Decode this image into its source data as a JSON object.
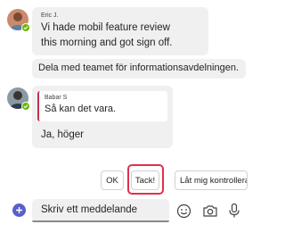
{
  "messages": [
    {
      "sender": "Eric J.",
      "lines": [
        "Vi hade mobil feature review",
        "this morning and got sign off."
      ],
      "followup": "Dela med teamet för informationsavdelningen."
    },
    {
      "sender": "Babar S",
      "quote_text": "Så kan det vara.",
      "reply": "Ja, höger"
    }
  ],
  "suggestions": [
    "OK",
    "Tack!",
    "Låt mig kontrollera"
  ],
  "composer": {
    "placeholder": "Skriv ett meddelande"
  },
  "icons": {
    "add": "plus-icon",
    "emoji": "emoji-icon",
    "camera": "camera-icon",
    "mic": "microphone-icon",
    "presence": "available-check-icon"
  },
  "colors": {
    "accent": "#5b5fc7",
    "presence": "#6bb700",
    "highlight": "#e0304e",
    "quote_bar": "#c4314b"
  }
}
